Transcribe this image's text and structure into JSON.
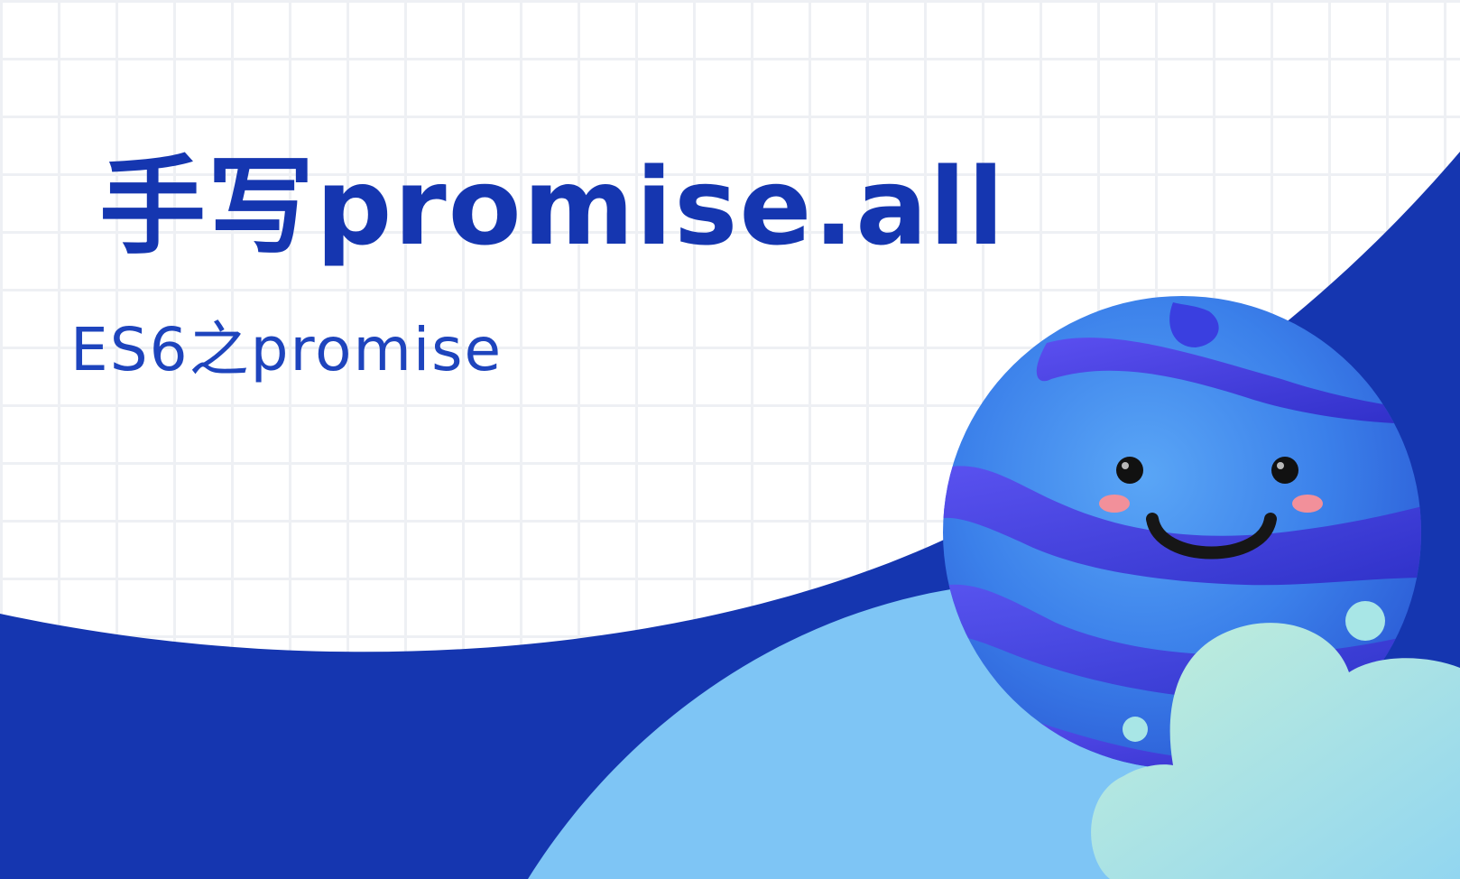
{
  "banner": {
    "title": "手写promise.all",
    "subtitle": "ES6之promise"
  },
  "colors": {
    "dark_wave": "#1536b0",
    "light_wave": "#7ec5f5",
    "grid": "#eef0f4",
    "text": "#1536b0",
    "mascot_body": "#3f86ec",
    "mascot_stripe": "#3a3fe0",
    "cloud": "#a8e6e6",
    "cheek": "#f2909a"
  },
  "illustration": {
    "mascot": "smiling-planet-mascot",
    "cloud": "cloud-icon"
  }
}
